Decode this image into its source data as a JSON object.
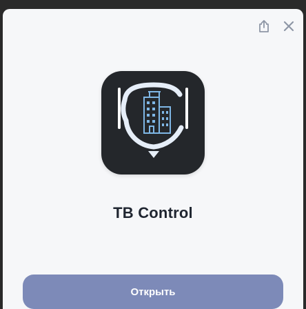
{
  "app": {
    "name": "TB Control"
  },
  "actions": {
    "open_label": "Открыть"
  },
  "icons": {
    "share": "share-icon",
    "close": "close-icon",
    "app": "app-logo-icon"
  },
  "colors": {
    "backdrop": "#2a2a2a",
    "sheet": "#f6f7f9",
    "icon_bg": "#24272b",
    "button": "#7d8ab8",
    "title_text": "#1f2530"
  }
}
